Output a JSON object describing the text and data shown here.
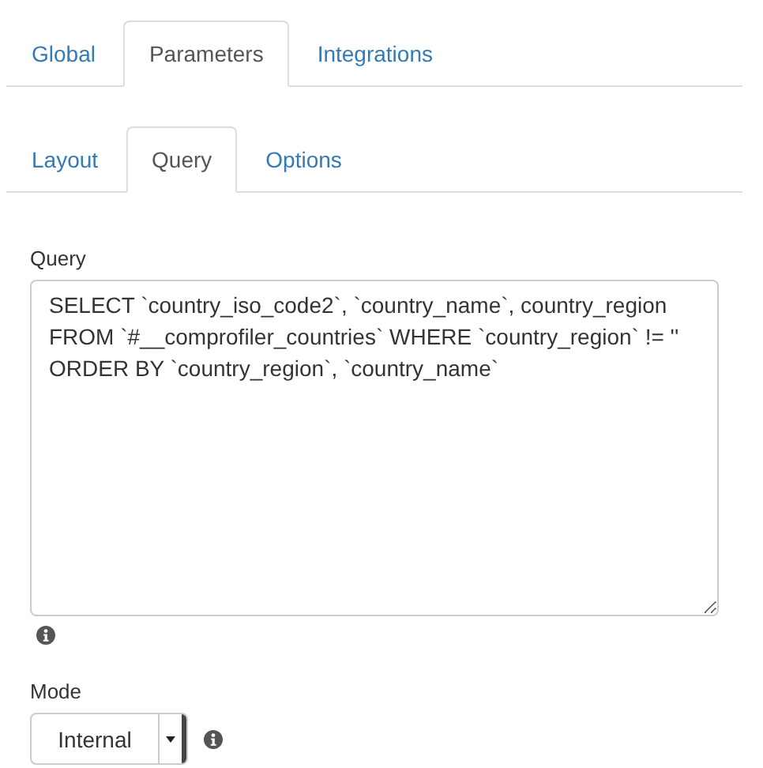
{
  "main_tabs": [
    {
      "label": "Global",
      "selected": false
    },
    {
      "label": "Parameters",
      "selected": true
    },
    {
      "label": "Integrations",
      "selected": false
    }
  ],
  "sub_tabs": [
    {
      "label": "Layout",
      "selected": false
    },
    {
      "label": "Query",
      "selected": true
    },
    {
      "label": "Options",
      "selected": false
    }
  ],
  "query": {
    "label": "Query",
    "value": "SELECT `country_iso_code2`, `country_name`, country_region\nFROM `#__comprofiler_countries` WHERE `country_region` != ''\nORDER BY `country_region`, `country_name`"
  },
  "mode": {
    "label": "Mode",
    "value": "Internal"
  }
}
